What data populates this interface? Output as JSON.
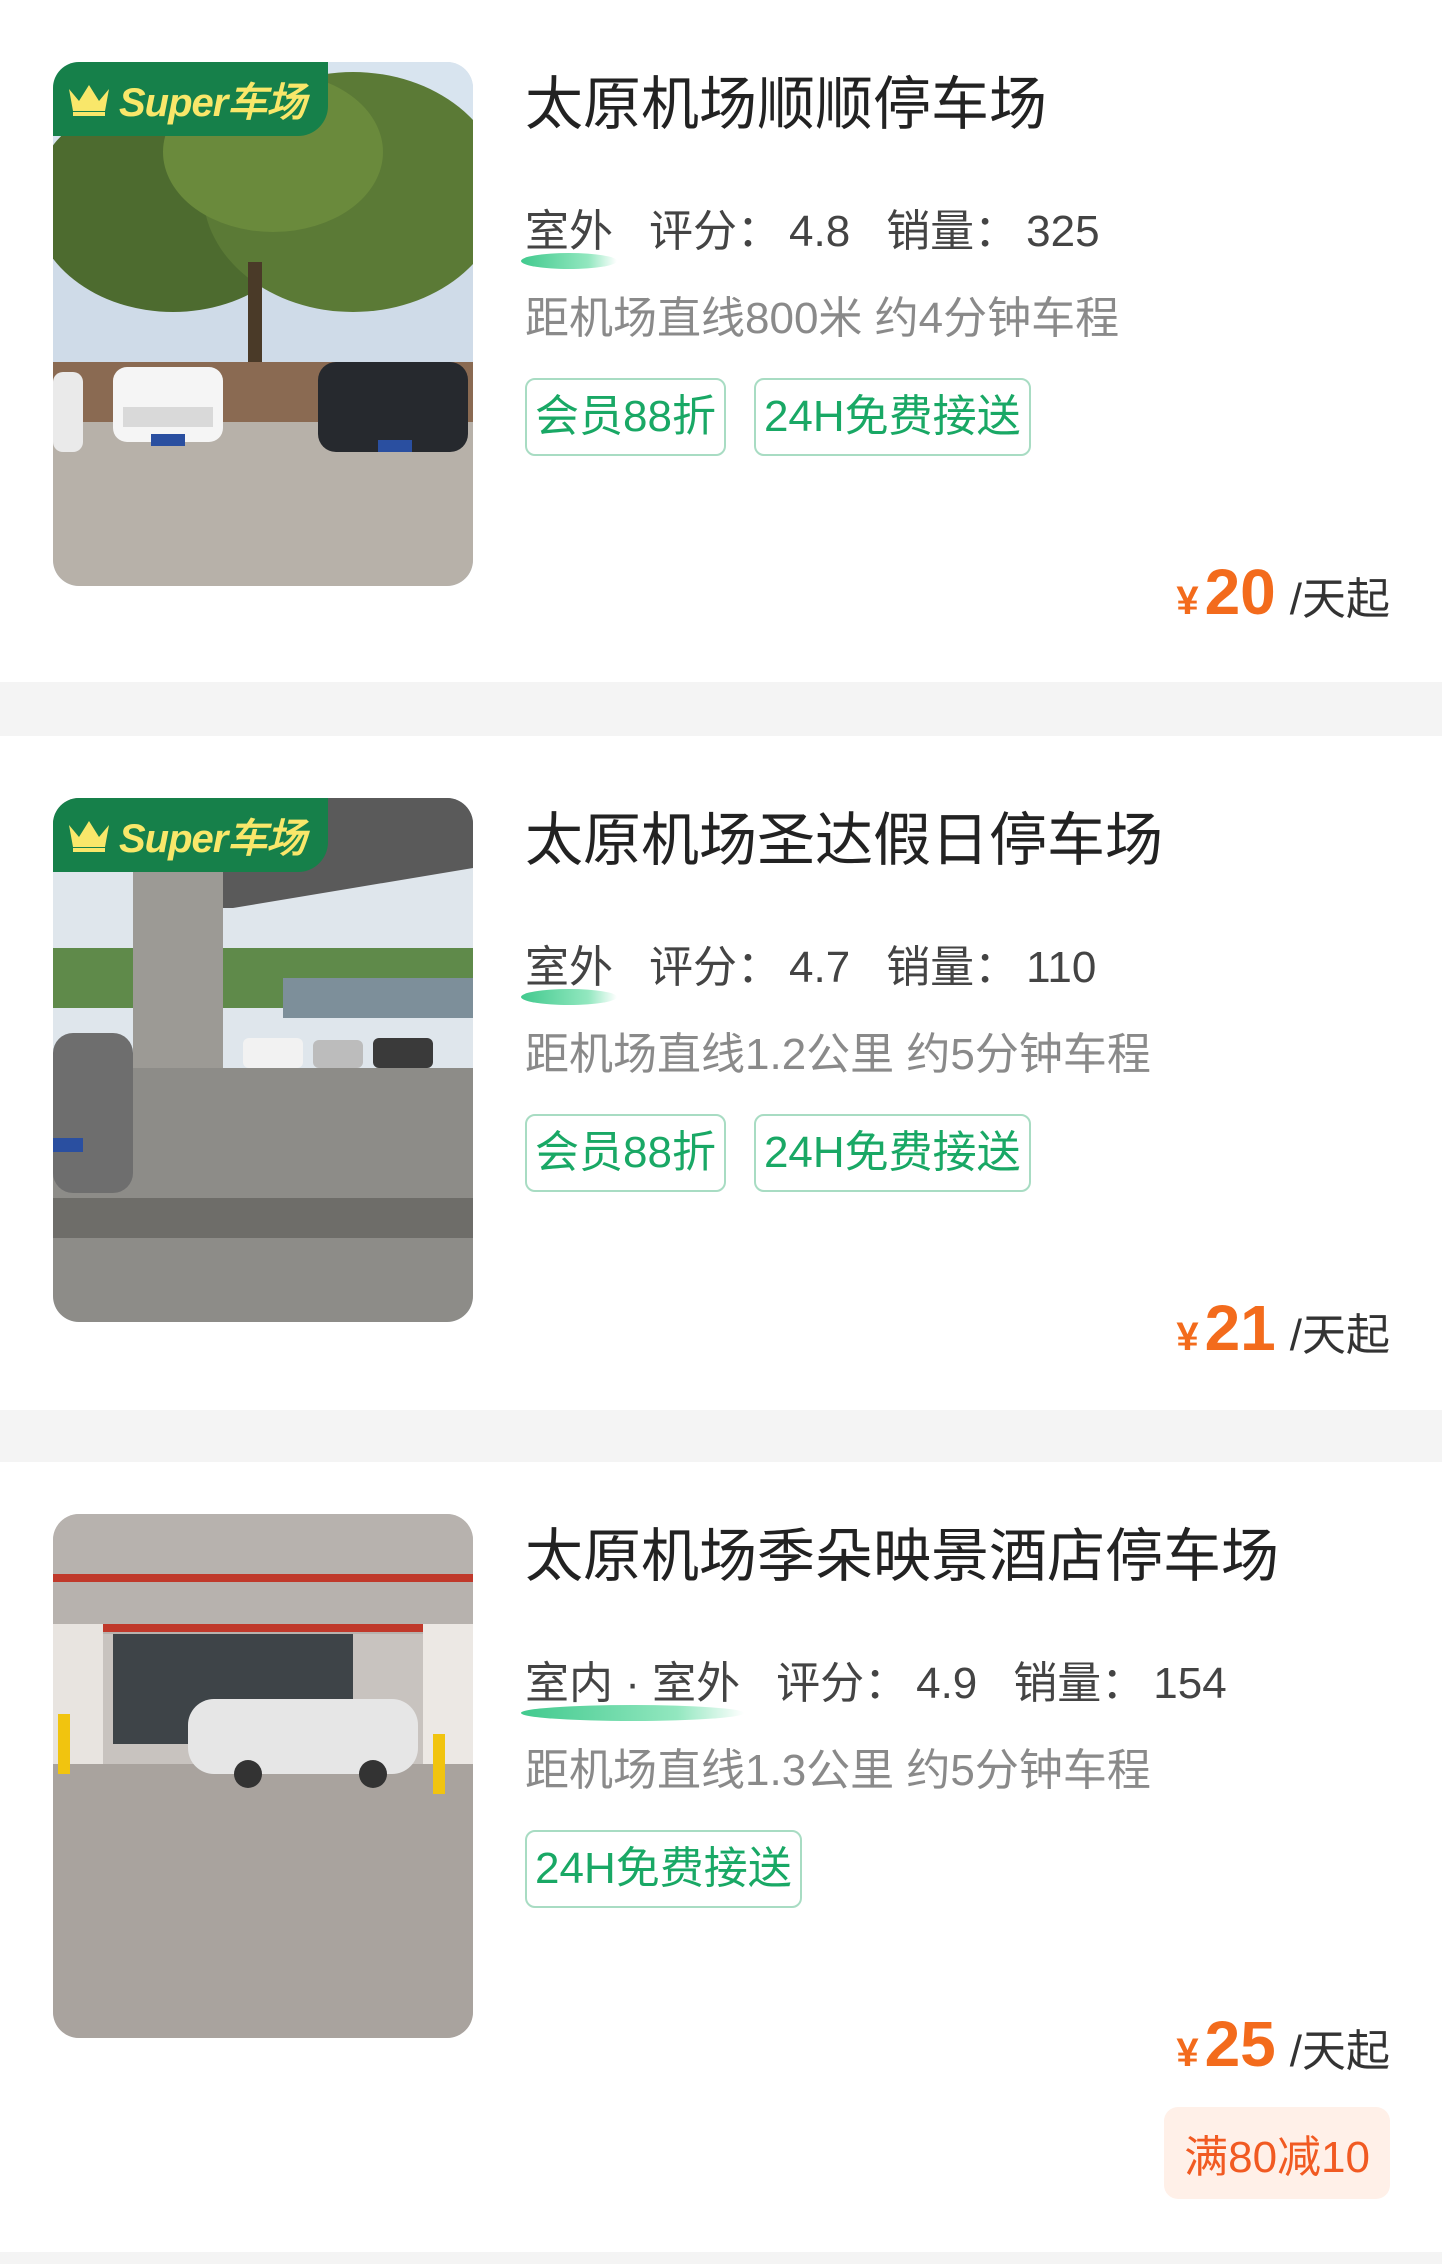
{
  "cards": [
    {
      "badge": "Super车场",
      "title": "太原机场顺顺停车场",
      "env": "室外",
      "rating_label": "评分：",
      "rating": "4.8",
      "sales_label": "销量：",
      "sales": "325",
      "distance": "距机场直线800米 约4分钟车程",
      "tags": [
        "会员88折",
        "24H免费接送"
      ],
      "currency": "¥",
      "price": "20",
      "unit": "/天起"
    },
    {
      "badge": "Super车场",
      "title": "太原机场圣达假日停车场",
      "env": "室外",
      "rating_label": "评分：",
      "rating": "4.7",
      "sales_label": "销量：",
      "sales": "110",
      "distance": "距机场直线1.2公里 约5分钟车程",
      "tags": [
        "会员88折",
        "24H免费接送"
      ],
      "currency": "¥",
      "price": "21",
      "unit": "/天起"
    },
    {
      "title": "太原机场季朵映景酒店停车场",
      "env": "室内 · 室外",
      "rating_label": "评分：",
      "rating": "4.9",
      "sales_label": "销量：",
      "sales": "154",
      "distance": "距机场直线1.3公里 约5分钟车程",
      "tags": [
        "24H免费接送"
      ],
      "currency": "¥",
      "price": "25",
      "unit": "/天起",
      "promo": "满80减10"
    }
  ],
  "colors": {
    "accent_green": "#19a865",
    "badge_green": "#16804a",
    "badge_text": "#f9e76a",
    "price_orange": "#f36b1c",
    "promo_bg": "#fff0e8"
  }
}
